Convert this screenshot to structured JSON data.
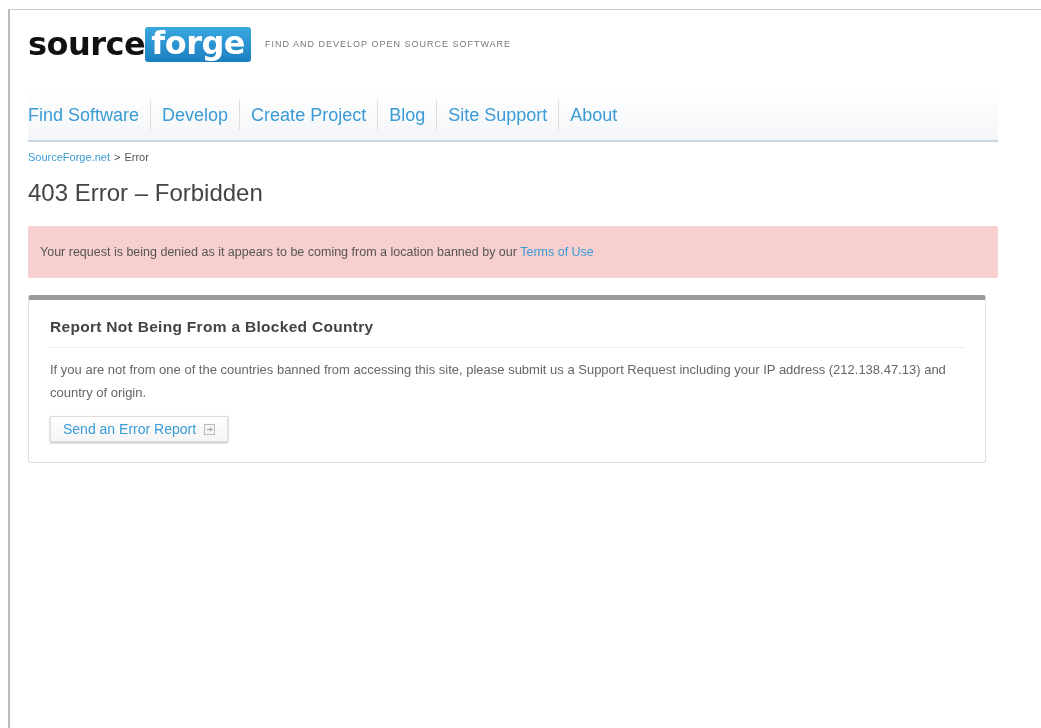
{
  "header": {
    "logo": {
      "prefix": "source",
      "highlight": "forge"
    },
    "tagline": "FIND AND DEVELOP OPEN SOURCE SOFTWARE"
  },
  "nav": [
    {
      "label": "Find Software"
    },
    {
      "label": "Develop"
    },
    {
      "label": "Create Project"
    },
    {
      "label": "Blog"
    },
    {
      "label": "Site Support"
    },
    {
      "label": "About"
    }
  ],
  "breadcrumb": {
    "link": "SourceForge.net",
    "separator": ">",
    "current": "Error"
  },
  "title": "403 Error – Forbidden",
  "alert": {
    "text": "Your request is being denied as it appears to be coming from a location banned by our ",
    "link": "Terms of Use"
  },
  "card": {
    "heading": "Report Not Being From a Blocked Country",
    "body": "If you are not from one of the countries banned from accessing this site, please submit us a Support Request including your IP address (212.138.47.13) and country of origin.",
    "button": "Send an Error Report"
  }
}
